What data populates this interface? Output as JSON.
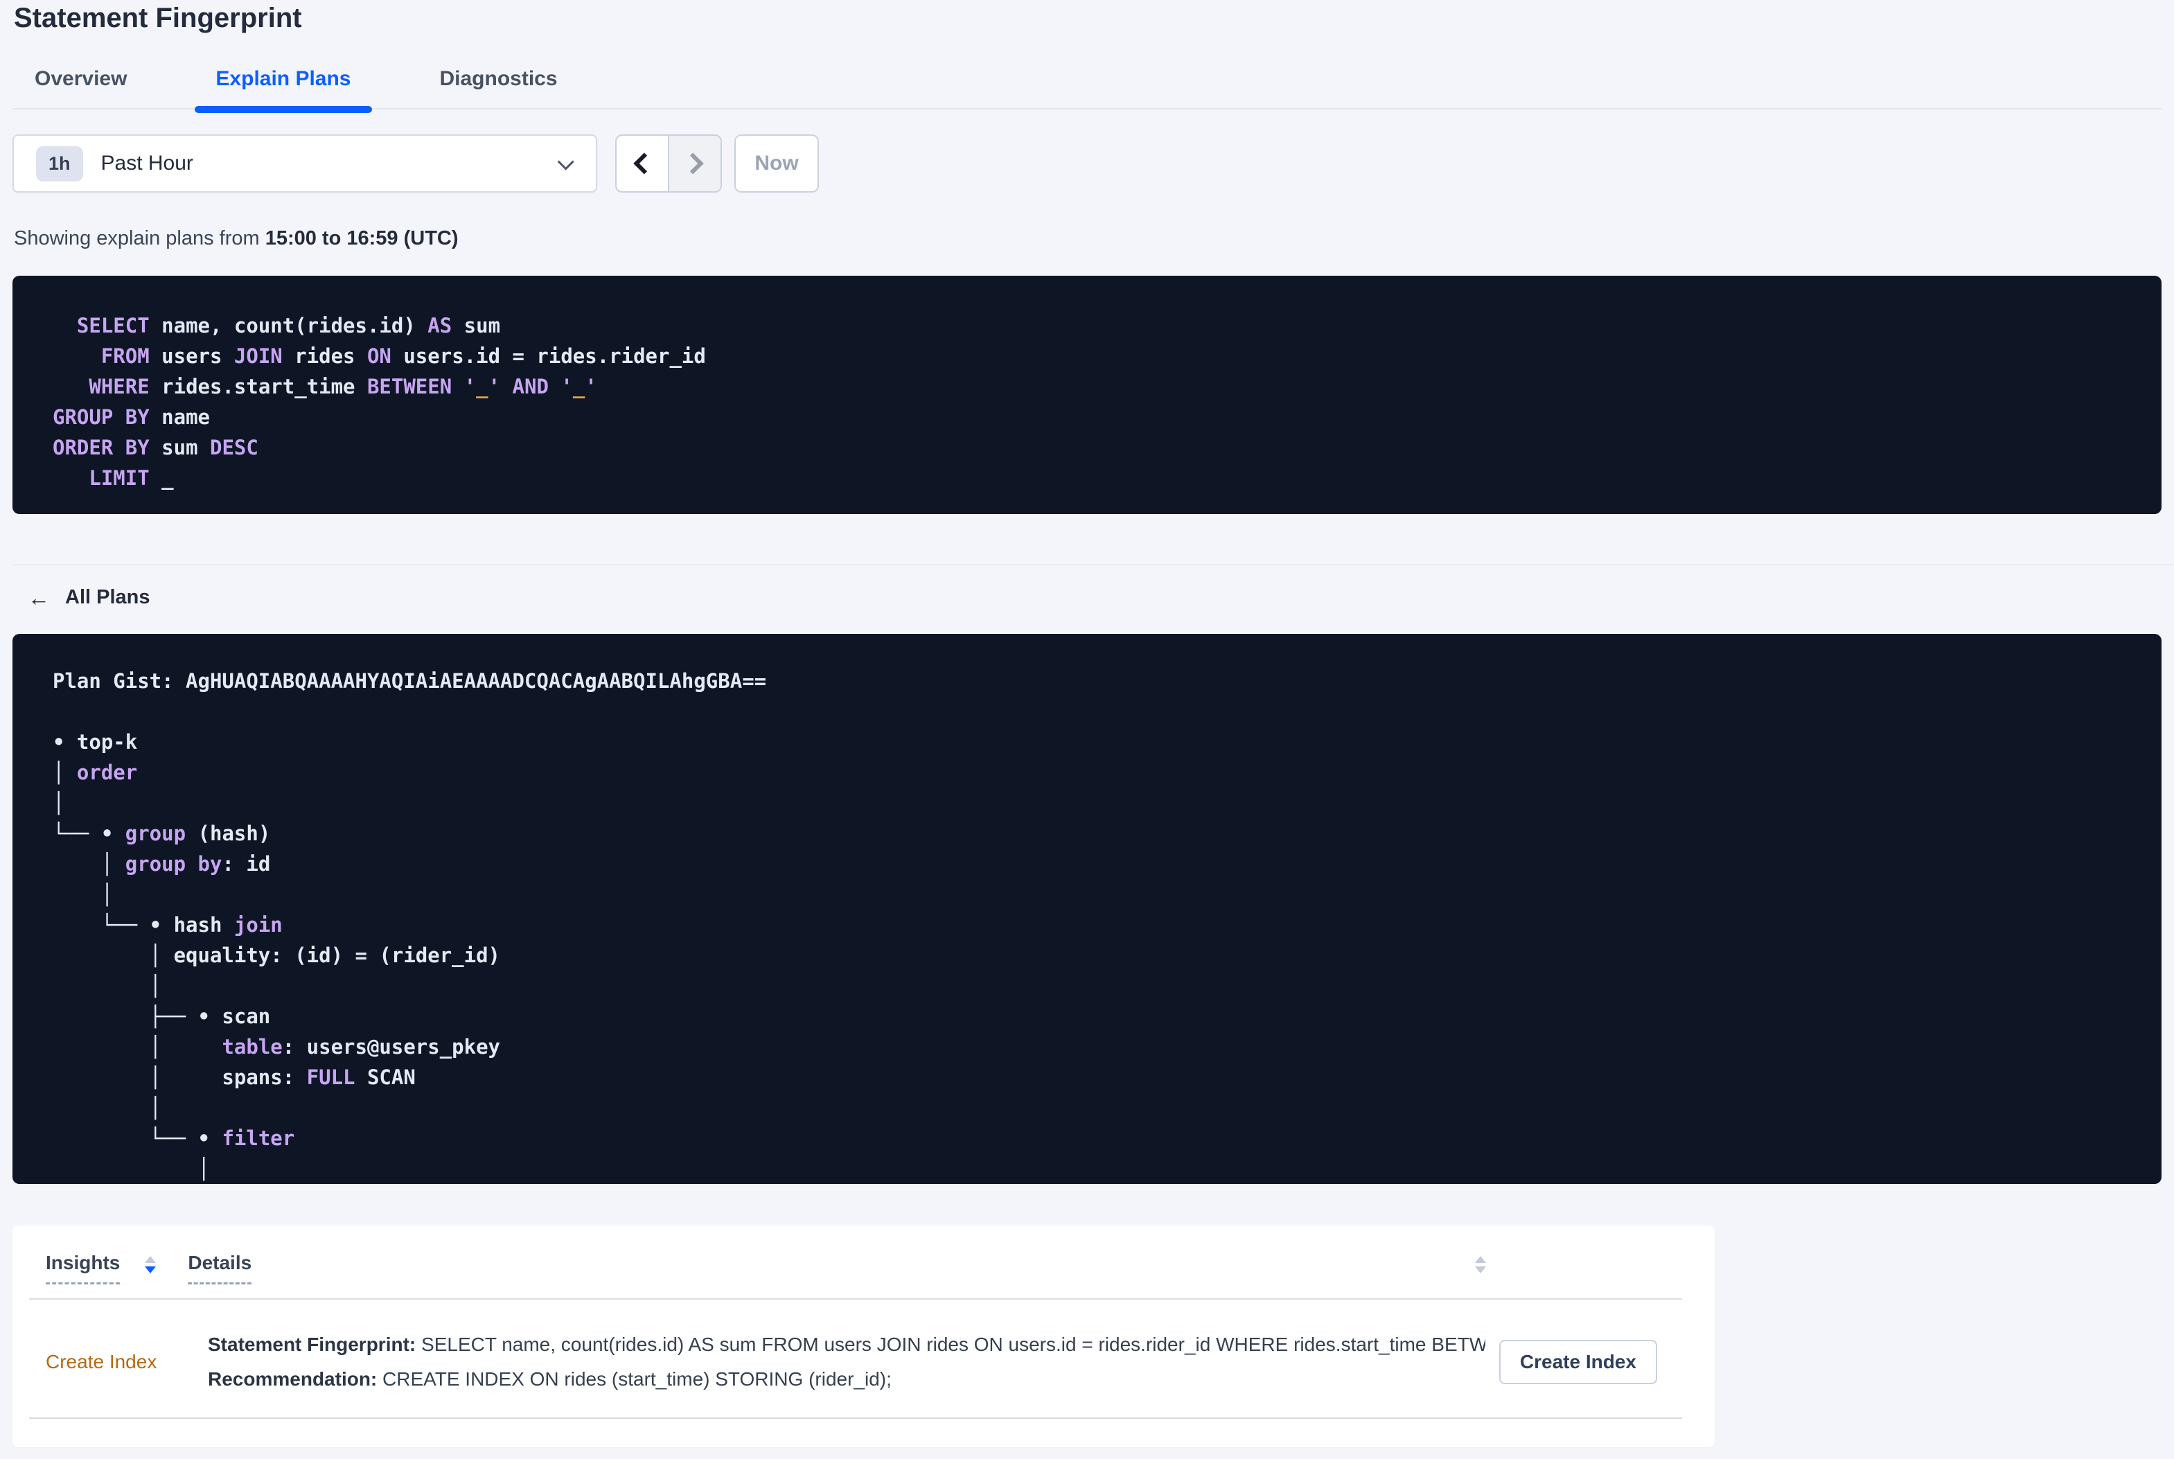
{
  "colors": {
    "accent_blue": "#0b5fff",
    "code_background": "#0e1626",
    "code_text": "#e4e9f2",
    "code_keyword": "#c7a5f1",
    "code_literal": "#eda23c",
    "insight_link": "#b5690e"
  },
  "header": {
    "title": "Statement Fingerprint"
  },
  "tabs": [
    {
      "label": "Overview"
    },
    {
      "label": "Explain Plans"
    },
    {
      "label": "Diagnostics"
    }
  ],
  "active_tab": "Explain Plans",
  "time_selector": {
    "duration_badge": "1h",
    "selected_range": "Past Hour",
    "now_label": "Now"
  },
  "showing": {
    "prefix": "Showing explain plans from ",
    "range": "15:00 to 16:59 (UTC)"
  },
  "sql_block": {
    "lines": [
      [
        [
          "k",
          "  SELECT"
        ],
        [
          "t",
          " name, count(rides.id) "
        ],
        [
          "k",
          "AS"
        ],
        [
          "t",
          " sum"
        ]
      ],
      [
        [
          "k",
          "    FROM"
        ],
        [
          "t",
          " users "
        ],
        [
          "k",
          "JOIN"
        ],
        [
          "t",
          " rides "
        ],
        [
          "k",
          "ON"
        ],
        [
          "t",
          " users.id = rides.rider_id"
        ]
      ],
      [
        [
          "k",
          "   WHERE"
        ],
        [
          "t",
          " rides.start_time "
        ],
        [
          "k",
          "BETWEEN"
        ],
        [
          "t",
          " "
        ],
        [
          "k",
          "'"
        ],
        [
          "o",
          "_"
        ],
        [
          "k",
          "'"
        ],
        [
          "t",
          " "
        ],
        [
          "k",
          "AND"
        ],
        [
          "t",
          " "
        ],
        [
          "k",
          "'"
        ],
        [
          "o",
          "_"
        ],
        [
          "k",
          "'"
        ]
      ],
      [
        [
          "k",
          "GROUP BY"
        ],
        [
          "t",
          " name"
        ]
      ],
      [
        [
          "k",
          "ORDER BY"
        ],
        [
          "t",
          " sum "
        ],
        [
          "k",
          "DESC"
        ]
      ],
      [
        [
          "k",
          "   LIMIT"
        ],
        [
          "t",
          " _"
        ]
      ]
    ]
  },
  "all_plans_link": {
    "label": "All Plans"
  },
  "plan_block": {
    "lines": [
      [
        [
          "t",
          "Plan Gist: AgHUAQIABQAAAAHYAQIAiAEAAAADCQACAgAABQILAhgGBA=="
        ]
      ],
      [],
      [
        [
          "t",
          "• top-k"
        ]
      ],
      [
        [
          "t",
          "│ "
        ],
        [
          "k",
          "order"
        ]
      ],
      [
        [
          "t",
          "│"
        ]
      ],
      [
        [
          "t",
          "└── • "
        ],
        [
          "k",
          "group"
        ],
        [
          "t",
          " (hash)"
        ]
      ],
      [
        [
          "t",
          "    │ "
        ],
        [
          "k",
          "group by"
        ],
        [
          "t",
          ": id"
        ]
      ],
      [
        [
          "t",
          "    │"
        ]
      ],
      [
        [
          "t",
          "    └── • hash "
        ],
        [
          "k",
          "join"
        ]
      ],
      [
        [
          "t",
          "        │ equality: (id) = (rider_id)"
        ]
      ],
      [
        [
          "t",
          "        │"
        ]
      ],
      [
        [
          "t",
          "        ├── • scan"
        ]
      ],
      [
        [
          "t",
          "        │     "
        ],
        [
          "k",
          "table"
        ],
        [
          "t",
          ": users@users_pkey"
        ]
      ],
      [
        [
          "t",
          "        │     spans: "
        ],
        [
          "k",
          "FULL"
        ],
        [
          "t",
          " SCAN"
        ]
      ],
      [
        [
          "t",
          "        │"
        ]
      ],
      [
        [
          "t",
          "        └── • "
        ],
        [
          "k",
          "filter"
        ]
      ],
      [
        [
          "t",
          "            │"
        ]
      ]
    ]
  },
  "insights_table": {
    "columns": [
      {
        "label": "Insights"
      },
      {
        "label": "Details"
      }
    ],
    "rows": [
      {
        "insight": "Create Index",
        "detail_lines": [
          {
            "label": "Statement Fingerprint:",
            "text": " SELECT name, count(rides.id) AS sum FROM users JOIN rides ON users.id = rides.rider_id WHERE rides.start_time BETWEEN '_…"
          },
          {
            "label": "Recommendation:",
            "text": " CREATE INDEX ON rides (start_time) STORING (rider_id);"
          }
        ],
        "action_label": "Create Index"
      }
    ]
  }
}
